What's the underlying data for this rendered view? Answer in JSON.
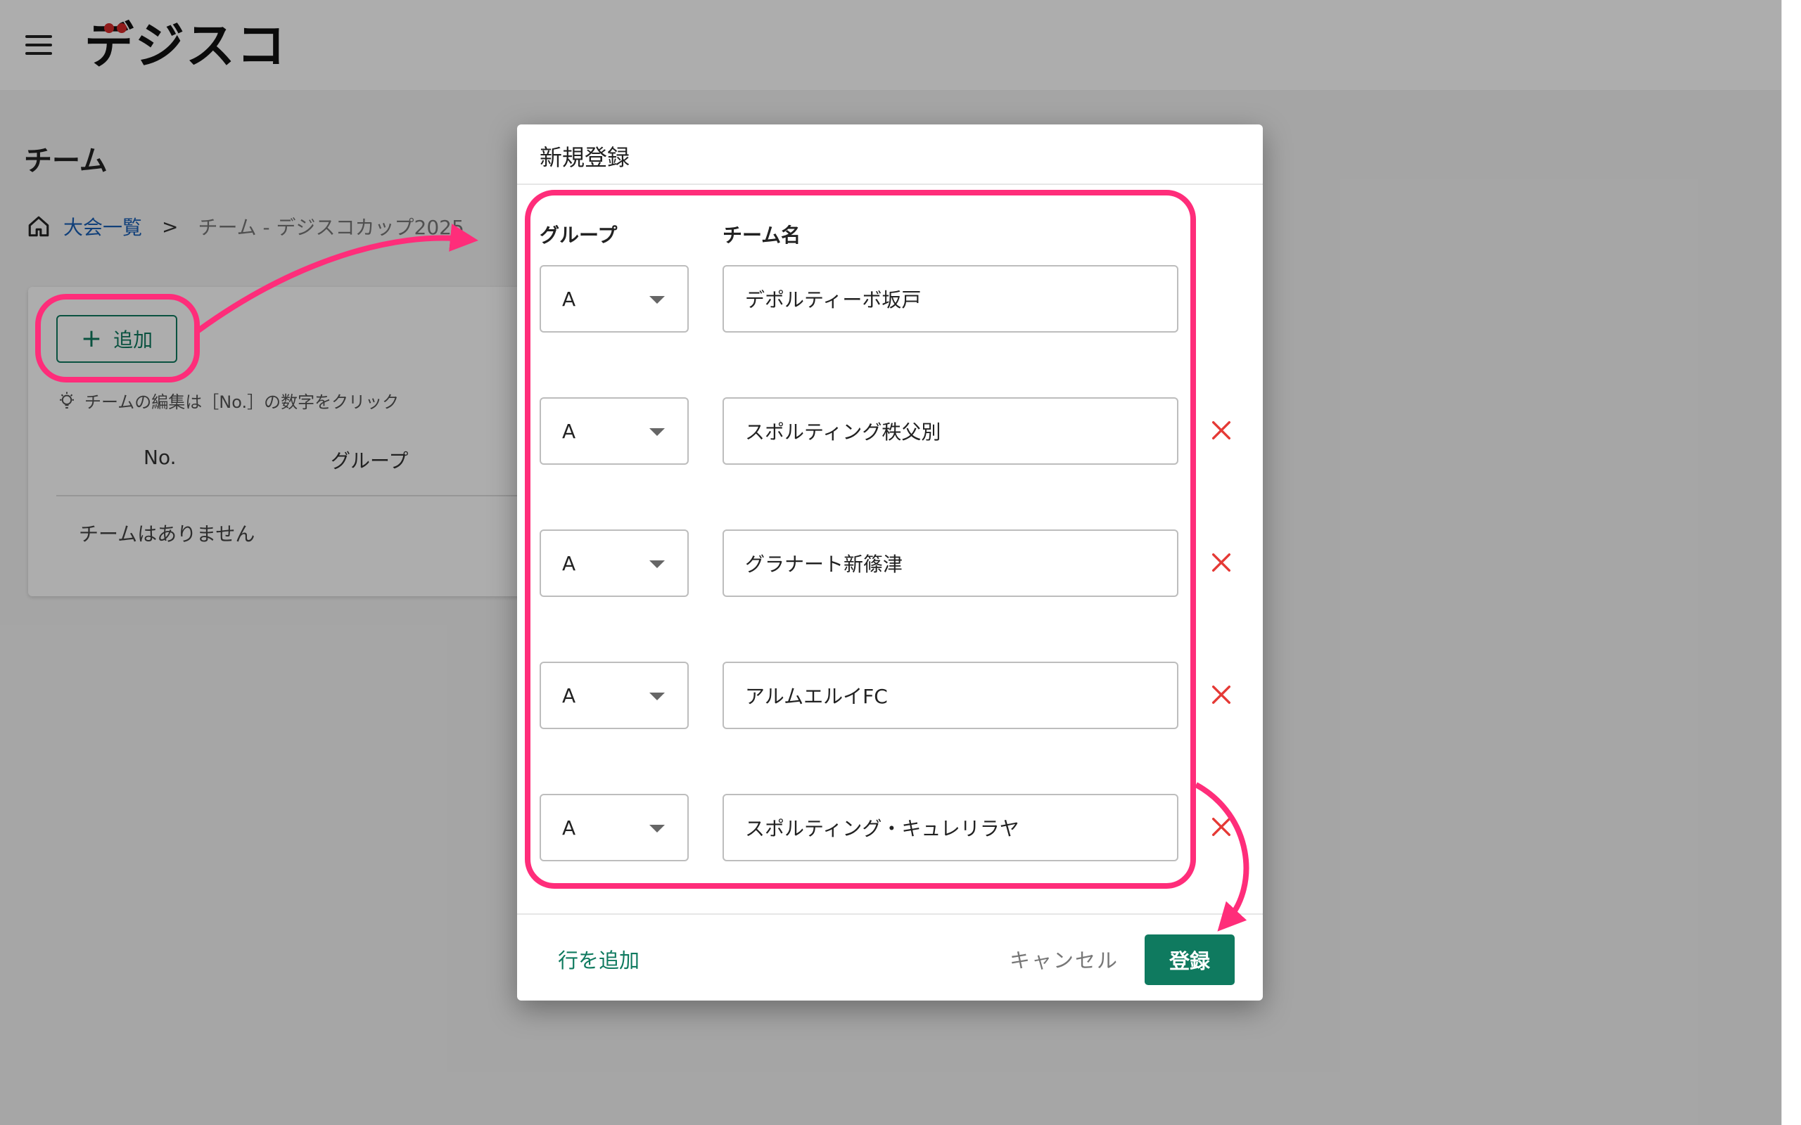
{
  "header": {
    "logo_text": "デジスコ",
    "menu_icon": "hamburger-menu-icon"
  },
  "page": {
    "title": "チーム",
    "breadcrumb": {
      "home_icon": "home-icon",
      "link": "大会一覧",
      "separator": ">",
      "current": "チーム - デジスコカップ2025"
    },
    "card": {
      "add_button": "追加",
      "hint": "チームの編集は［No.］の数字をクリック",
      "columns": [
        "No.",
        "グループ"
      ],
      "empty_message": "チームはありません"
    }
  },
  "dialog": {
    "title": "新規登録",
    "column_group": "グループ",
    "column_name": "チーム名",
    "rows": [
      {
        "group": "A",
        "name": "デポルティーボ坂戸"
      },
      {
        "group": "A",
        "name": "スポルティング秩父別"
      },
      {
        "group": "A",
        "name": "グラナート新篠津"
      },
      {
        "group": "A",
        "name": "アルムエルイFC"
      },
      {
        "group": "A",
        "name": "スポルティング・キュレリラヤ"
      }
    ],
    "add_row": "行を追加",
    "cancel": "キャンセル",
    "submit": "登録"
  },
  "colors": {
    "accent_green": "#0f7a5f",
    "delete_red": "#e53935",
    "annotation_pink": "#ff2d7a"
  }
}
